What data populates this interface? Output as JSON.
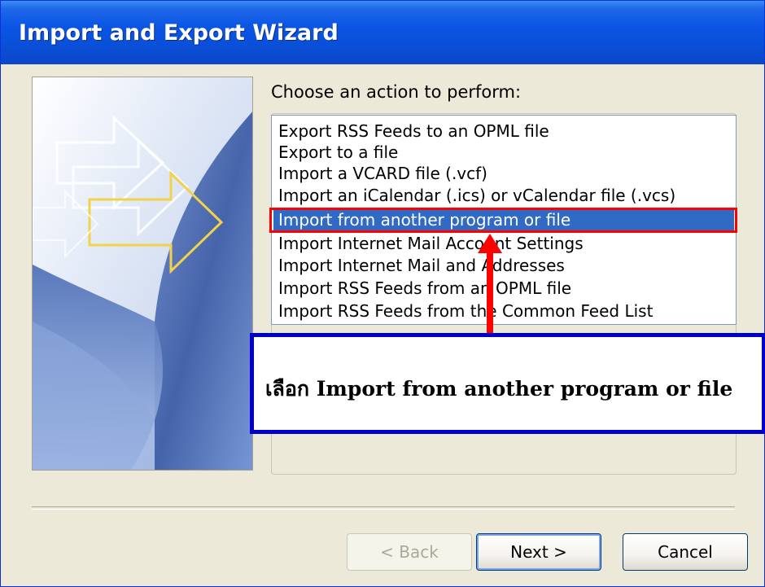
{
  "window": {
    "title": "Import and Export Wizard"
  },
  "prompt": "Choose an action to perform:",
  "actions": {
    "items": [
      "Export RSS Feeds to an OPML file",
      "Export to a file",
      "Import a VCARD file (.vcf)",
      "Import an iCalendar (.ics) or vCalendar file (.vcs)",
      "Import from another program or file",
      "Import Internet Mail Account Settings",
      "Import Internet Mail and Addresses",
      "Import RSS Feeds from an OPML file",
      "Import RSS Feeds from the Common Feed List"
    ],
    "selected_index": 4
  },
  "annotation": {
    "text": "เลือก Import from another program or file",
    "highlight_color": "#ff0000",
    "callout_border_color": "#0000cc"
  },
  "buttons": {
    "back": "< Back",
    "next": "Next >",
    "cancel": "Cancel"
  },
  "colors": {
    "titlebar": "#0b55e5",
    "selection": "#316ac5",
    "dialog_bg": "#ece9d8"
  }
}
